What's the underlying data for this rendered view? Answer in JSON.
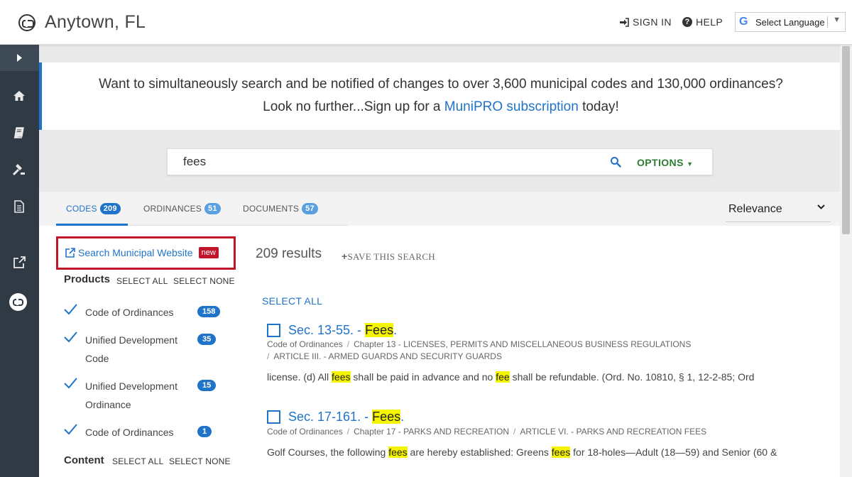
{
  "header": {
    "city": "Anytown, FL",
    "sign_in": "SIGN IN",
    "help": "HELP",
    "language_label": "Select Language"
  },
  "banner": {
    "line1": "Want to simultaneously search and be notified of changes to over 3,600 municipal codes and 130,000 ordinances?",
    "line2_prefix": "Look no further...Sign up for a ",
    "line2_link": "MuniPRO subscription",
    "line2_suffix": " today!"
  },
  "search": {
    "value": "fees",
    "options_label": "OPTIONS"
  },
  "tabs": [
    {
      "label": "CODES",
      "count": "209",
      "active": true
    },
    {
      "label": "ORDINANCES",
      "count": "51",
      "active": false
    },
    {
      "label": "DOCUMENTS",
      "count": "57",
      "active": false
    }
  ],
  "sort": {
    "selected": "Relevance"
  },
  "filters": {
    "external_link": "Search Municipal Website",
    "new_badge": "new",
    "products_heading": "Products",
    "content_heading": "Content",
    "select_all": "SELECT ALL",
    "select_none": "SELECT NONE",
    "products": [
      {
        "label": "Code of Ordinances",
        "count": "158"
      },
      {
        "label": "Unified Development Code",
        "count": "35"
      },
      {
        "label": "Unified Development Ordinance",
        "count": "15"
      },
      {
        "label": "Code of Ordinances",
        "count": "1"
      }
    ]
  },
  "results": {
    "count_text": "209 results",
    "save_search": "SAVE THIS SEARCH",
    "select_all": "SELECT ALL",
    "items": [
      {
        "title_prefix": "Sec. 13-55. - ",
        "title_highlight": "Fees",
        "title_suffix": ".",
        "crumbs": [
          "Code of Ordinances",
          "Chapter 13 - LICENSES, PERMITS AND MISCELLANEOUS BUSINESS REGULATIONS",
          "ARTICLE III. - ARMED GUARDS AND SECURITY GUARDS"
        ],
        "snippet": [
          {
            "t": "license. (d) All ",
            "h": false
          },
          {
            "t": "fees",
            "h": true
          },
          {
            "t": " shall be paid in advance and no ",
            "h": false
          },
          {
            "t": "fee",
            "h": true
          },
          {
            "t": " shall be refundable. (Ord. No. 10810, § 1, 12-2-85; Ord",
            "h": false
          }
        ]
      },
      {
        "title_prefix": "Sec. 17-161. - ",
        "title_highlight": "Fees",
        "title_suffix": ".",
        "crumbs": [
          "Code of Ordinances",
          "Chapter 17 - PARKS AND RECREATION",
          "ARTICLE VI. - PARKS AND RECREATION FEES"
        ],
        "snippet": [
          {
            "t": "Golf Courses, the following ",
            "h": false
          },
          {
            "t": "fees",
            "h": true
          },
          {
            "t": " are hereby established: Greens ",
            "h": false
          },
          {
            "t": "fees",
            "h": true
          },
          {
            "t": " for 18-holes—Adult (18—59) and Senior (60 &",
            "h": false
          }
        ]
      }
    ]
  },
  "colors": {
    "accent": "#1f73c8",
    "sidebar": "#2f3a45",
    "highlight": "#f5f500",
    "options": "#2e7d32",
    "new_badge": "#c0162c"
  }
}
